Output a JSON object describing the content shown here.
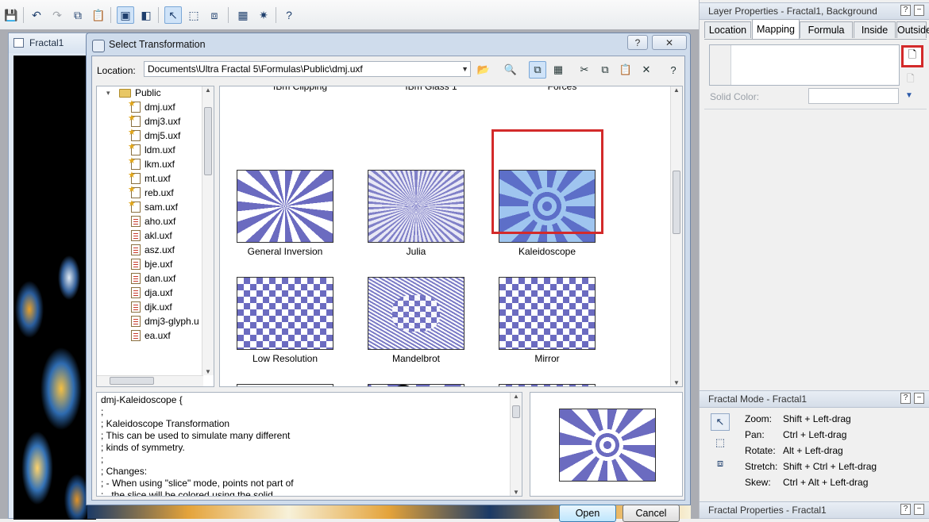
{
  "toolbar": {
    "items": [
      "save",
      "undo",
      "redo",
      "copy",
      "paste",
      "view-fractal",
      "view-split",
      "select",
      "transform-nodes",
      "stretch",
      "render",
      "settings",
      "help"
    ]
  },
  "fractal_window": {
    "title": "Fractal1"
  },
  "dialog": {
    "title": "Select Transformation",
    "help_label": "?",
    "close_label": "✕",
    "location_label": "Location:",
    "location_value": "Documents\\Ultra Fractal 5\\Formulas\\Public\\dmj.uxf",
    "tree": {
      "root": "Public",
      "files": [
        {
          "name": "dmj.uxf",
          "icon": "star-file-icon"
        },
        {
          "name": "dmj3.uxf",
          "icon": "star-file-icon"
        },
        {
          "name": "dmj5.uxf",
          "icon": "star-file-icon"
        },
        {
          "name": "ldm.uxf",
          "icon": "star-file-icon"
        },
        {
          "name": "lkm.uxf",
          "icon": "star-file-icon"
        },
        {
          "name": "mt.uxf",
          "icon": "star-file-icon"
        },
        {
          "name": "reb.uxf",
          "icon": "star-file-icon"
        },
        {
          "name": "sam.uxf",
          "icon": "star-file-icon"
        },
        {
          "name": "aho.uxf",
          "icon": "page-file-icon"
        },
        {
          "name": "akl.uxf",
          "icon": "page-file-icon"
        },
        {
          "name": "asz.uxf",
          "icon": "page-file-icon"
        },
        {
          "name": "bje.uxf",
          "icon": "page-file-icon"
        },
        {
          "name": "dan.uxf",
          "icon": "page-file-icon"
        },
        {
          "name": "dja.uxf",
          "icon": "page-file-icon"
        },
        {
          "name": "djk.uxf",
          "icon": "page-file-icon"
        },
        {
          "name": "dmj3-glyph.u",
          "icon": "page-file-icon"
        },
        {
          "name": "ea.uxf",
          "icon": "page-file-icon"
        }
      ]
    },
    "gallery": {
      "top_labels": [
        "fBm Clipping",
        "fBm Glass 1",
        "Forces"
      ],
      "items": [
        {
          "label": "General Inversion",
          "pattern": "inversion"
        },
        {
          "label": "Julia",
          "pattern": "julia"
        },
        {
          "label": "Kaleidoscope",
          "pattern": "kaleido",
          "selected": true
        },
        {
          "label": "Low Resolution",
          "pattern": "checker"
        },
        {
          "label": "Mandelbrot",
          "pattern": "mandel"
        },
        {
          "label": "Mirror",
          "pattern": "checker"
        },
        {
          "label": "",
          "pattern": "blobs"
        },
        {
          "label": "",
          "pattern": "circles"
        },
        {
          "label": "",
          "pattern": "checker"
        }
      ]
    },
    "description": [
      "dmj-Kaleidoscope {",
      ";",
      "; Kaleidoscope Transformation",
      "; This can be used to simulate many different",
      "; kinds of symmetry.",
      ";",
      "; Changes:",
      "; - When using \"slice\" mode, points not part of",
      ";   the slice will be colored using the solid"
    ],
    "open_label": "Open",
    "cancel_label": "Cancel"
  },
  "layer_properties": {
    "title": "Layer Properties - Fractal1, Background",
    "tabs": [
      "Location",
      "Mapping",
      "Formula",
      "Inside",
      "Outside"
    ],
    "active_tab": "Mapping",
    "solid_color_label": "Solid Color:"
  },
  "fractal_mode": {
    "title": "Fractal Mode - Fractal1",
    "rows": [
      {
        "action": "Zoom:",
        "keys": "Shift + Left-drag"
      },
      {
        "action": "Pan:",
        "keys": "Ctrl + Left-drag"
      },
      {
        "action": "Rotate:",
        "keys": "Alt + Left-drag"
      },
      {
        "action": "Stretch:",
        "keys": "Shift + Ctrl + Left-drag"
      },
      {
        "action": "Skew:",
        "keys": "Ctrl + Alt + Left-drag"
      }
    ]
  },
  "fractal_properties": {
    "title": "Fractal Properties - Fractal1"
  },
  "colors": {
    "highlight": "#d32a2a",
    "pattern_blue": "#6b6bc0",
    "kaleido_light": "#9fc5ef"
  }
}
